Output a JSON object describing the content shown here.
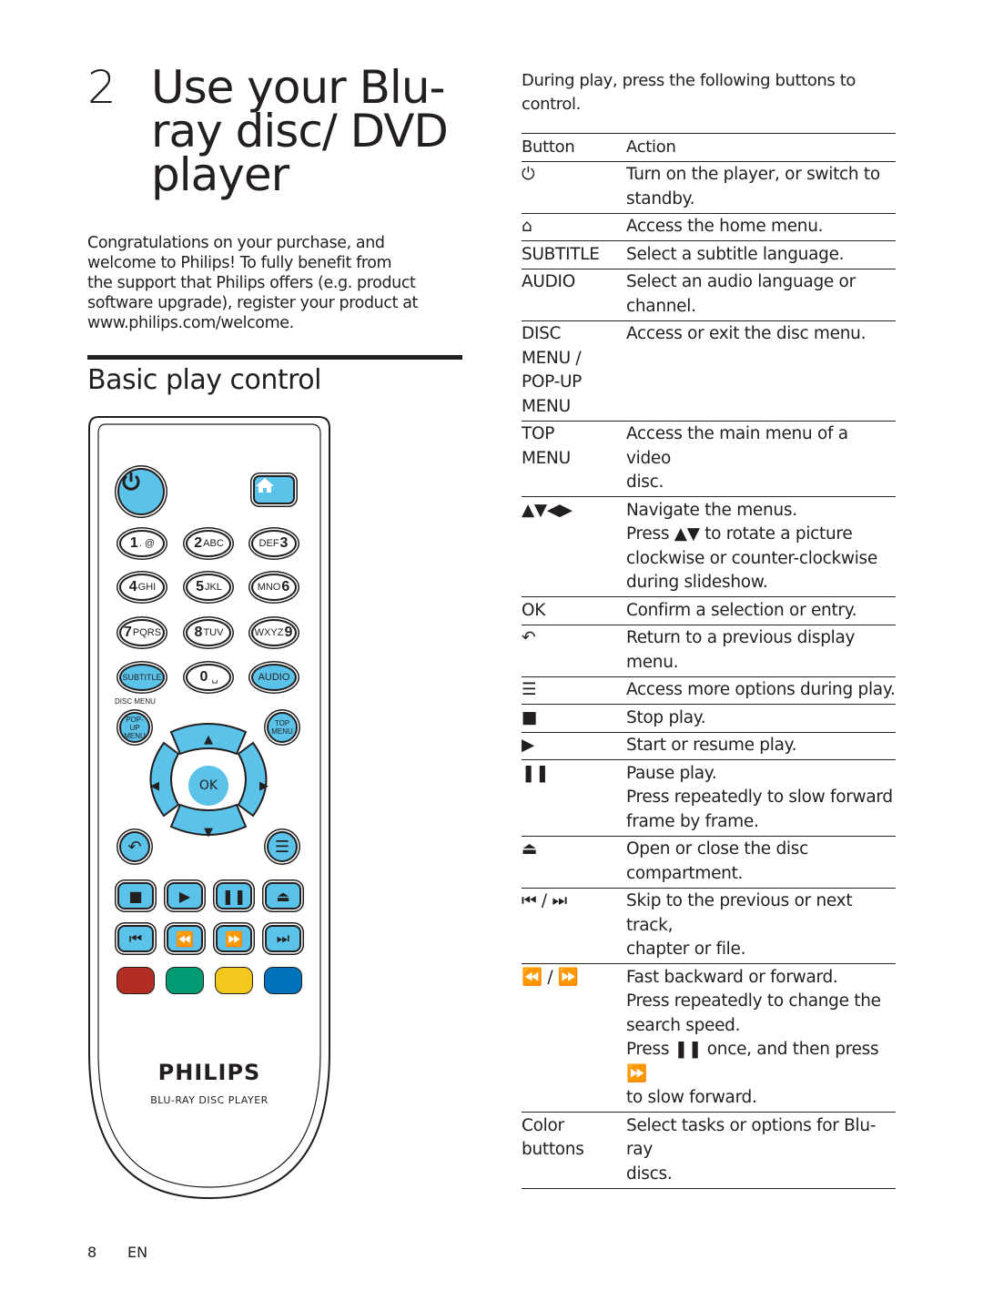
{
  "chapter": {
    "number": "2",
    "title_lines": [
      "Use your Blu-",
      "ray disc/ DVD",
      "player"
    ]
  },
  "intro_lines": [
    "Congratulations on your purchase, and",
    "welcome to Philips! To fully benefit from",
    "the support that Philips offers (e.g. product",
    "software upgrade), register your product at",
    "www.philips.com/welcome."
  ],
  "section_title": "Basic play control",
  "remote": {
    "power_icon": "power-icon",
    "home_icon": "home-icon",
    "keypad": [
      {
        "num": "1",
        "letters": ". @",
        "order": "num-first"
      },
      {
        "num": "2",
        "letters": "ABC",
        "order": "num-first"
      },
      {
        "num": "3",
        "letters": "DEF",
        "order": "letters-first"
      },
      {
        "num": "4",
        "letters": "GHI",
        "order": "num-first"
      },
      {
        "num": "5",
        "letters": "JKL",
        "order": "num-first"
      },
      {
        "num": "6",
        "letters": "MNO",
        "order": "letters-first"
      },
      {
        "num": "7",
        "letters": "PQRS",
        "order": "num-first"
      },
      {
        "num": "8",
        "letters": "TUV",
        "order": "num-first"
      },
      {
        "num": "9",
        "letters": "WXYZ",
        "order": "letters-first"
      }
    ],
    "subtitle_label": "SUBTITLE",
    "zero_label": "0",
    "zero_sub": "␣",
    "audio_label": "AUDIO",
    "disc_menu_label": "DISC MENU",
    "popup_menu_label": [
      "POP-UP",
      "MENU"
    ],
    "top_menu_label": [
      "TOP",
      "MENU"
    ],
    "ok_label": "OK",
    "nav_glyphs": {
      "up": "▲",
      "down": "▼",
      "left": "◀",
      "right": "▶"
    },
    "media_row1": [
      "■",
      "▶",
      "❚❚",
      "⏏"
    ],
    "media_row2": [
      "⏮",
      "⏪",
      "⏩",
      "⏭"
    ],
    "color_buttons": [
      "#b22e22",
      "#009a73",
      "#f2c81e",
      "#0072bc"
    ],
    "brand_name": "PHILIPS",
    "brand_sub": "BLU-RAY DISC PLAYER",
    "accent_color": "#5bc3ea"
  },
  "lead_text": "During play, press the following buttons to control.",
  "table": {
    "headers": {
      "button": "Button",
      "action": "Action"
    },
    "rows": [
      {
        "button": "⏻",
        "action": "Turn on the player, or switch to\nstandby."
      },
      {
        "button": "⌂",
        "action": "Access the home menu."
      },
      {
        "button": "SUBTITLE",
        "action": "Select a subtitle language."
      },
      {
        "button": "AUDIO",
        "action": "Select an audio language or\nchannel."
      },
      {
        "button": "DISC\nMENU /\nPOP-UP\nMENU",
        "action": "Access or exit the disc menu."
      },
      {
        "button": "TOP\nMENU",
        "action": "Access the main menu of a video\ndisc."
      },
      {
        "button": "▲▼◀▶",
        "action": "Navigate the menus.\nPress ▲▼ to rotate a picture\nclockwise or counter-clockwise\nduring slideshow."
      },
      {
        "button": "OK",
        "action": "Confirm a selection or entry."
      },
      {
        "button": "↶",
        "action": "Return to a previous display menu."
      },
      {
        "button": "☰",
        "action": "Access more options during play."
      },
      {
        "button": "■",
        "action": "Stop play."
      },
      {
        "button": "▶",
        "action": "Start or resume play."
      },
      {
        "button": "❚❚",
        "action": "Pause play.\nPress repeatedly to slow forward\nframe by frame."
      },
      {
        "button": "⏏",
        "action": "Open or close the disc\ncompartment."
      },
      {
        "button": "⏮ / ⏭",
        "action": "Skip to the previous or next track,\nchapter or file."
      },
      {
        "button": "⏪ / ⏩",
        "action": "Fast backward or forward.\nPress repeatedly to change the\nsearch speed.\nPress ❚❚ once, and then press ⏩\nto slow forward."
      },
      {
        "button": "Color\nbuttons",
        "action": "Select tasks or options for Blu-ray\ndiscs."
      }
    ]
  },
  "footer": {
    "page_number": "8",
    "language": "EN"
  }
}
